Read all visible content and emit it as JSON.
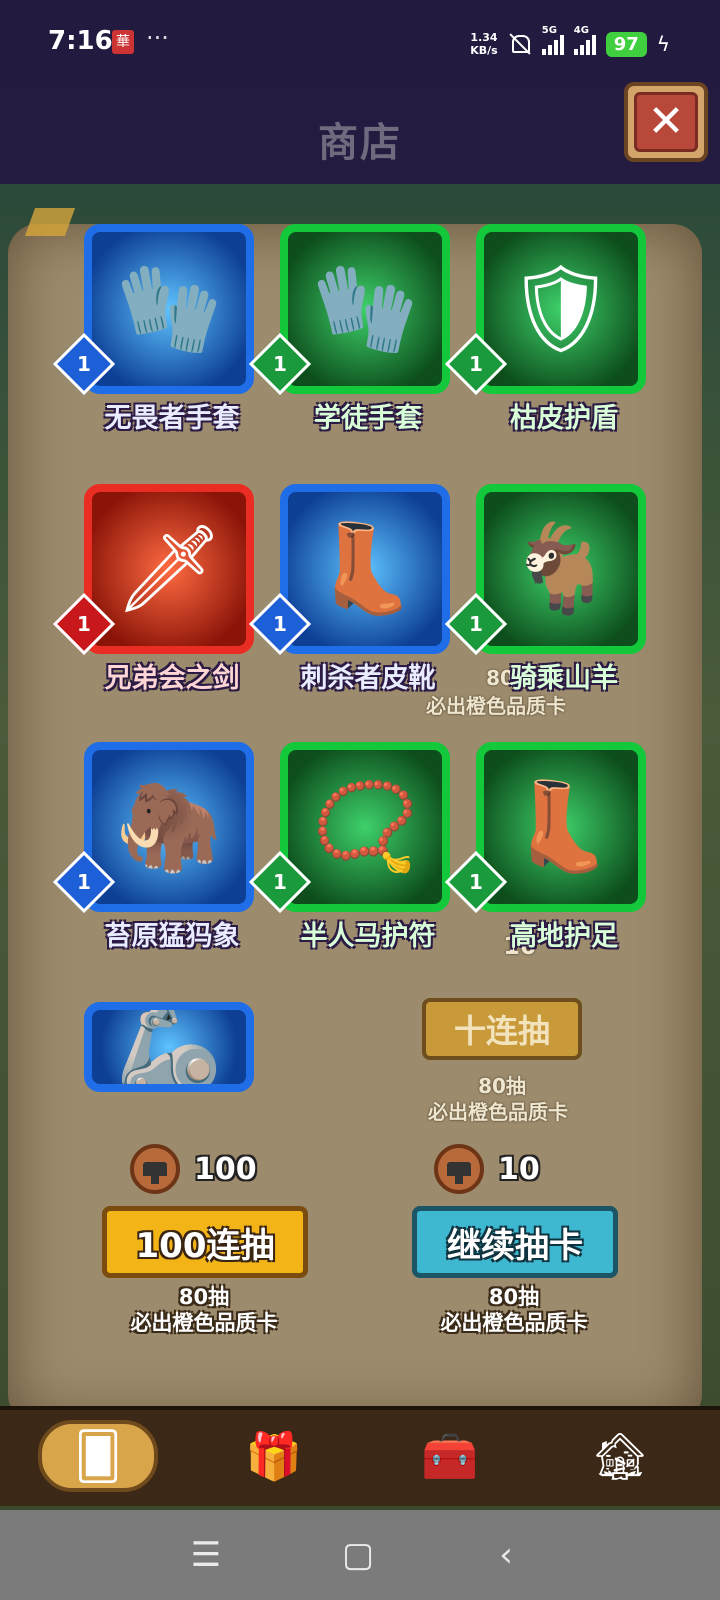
{
  "status_bar": {
    "time": "7:16",
    "app_badge": "華",
    "more": "···",
    "net_speed_value": "1.34",
    "net_speed_unit": "KB/s",
    "signal_1": "5G",
    "signal_2": "4G",
    "battery": "97"
  },
  "header": {
    "title": "商店",
    "close_label": "✕"
  },
  "items": [
    {
      "name": "无畏者手套",
      "level": "1",
      "rarity": "blue",
      "icon": "gauntlet-icon"
    },
    {
      "name": "学徒手套",
      "level": "1",
      "rarity": "green",
      "icon": "glove-icon"
    },
    {
      "name": "枯皮护盾",
      "level": "1",
      "rarity": "green",
      "icon": "shield-icon"
    },
    {
      "name": "兄弟会之剑",
      "level": "1",
      "rarity": "red",
      "icon": "sword-icon"
    },
    {
      "name": "刺杀者皮靴",
      "level": "1",
      "rarity": "blue",
      "icon": "boots-icon"
    },
    {
      "name": "骑乘山羊",
      "level": "1",
      "rarity": "green",
      "icon": "goat-icon"
    },
    {
      "name": "苔原猛犸象",
      "level": "1",
      "rarity": "blue",
      "icon": "mammoth-icon"
    },
    {
      "name": "半人马护符",
      "level": "1",
      "rarity": "green",
      "icon": "amulet-icon"
    },
    {
      "name": "高地护足",
      "level": "1",
      "rarity": "green",
      "icon": "greaves-icon"
    },
    {
      "name": "",
      "level": "",
      "rarity": "blue",
      "icon": "bracer-icon"
    }
  ],
  "background": {
    "ten_draw_label": "十连抽",
    "ghost_guarantee_count": "80抽",
    "ghost_guarantee_text": "必出橙色品质卡",
    "ghost_partial_count": "80",
    "ghost_partial_text": "必出橙色品质卡",
    "ghost_cost": "10"
  },
  "draw_panel": {
    "left": {
      "cost": "100",
      "button": "100连抽",
      "count": "80抽",
      "guarantee": "必出橙色品质卡"
    },
    "right": {
      "cost": "10",
      "button": "继续抽卡",
      "count": "80抽",
      "guarantee": "必出橙色品质卡"
    }
  },
  "bottom_nav": [
    {
      "icon": "card-deck-icon",
      "glyph": "🂠",
      "active": true
    },
    {
      "icon": "gift-icon",
      "glyph": "🎁",
      "active": false
    },
    {
      "icon": "treasure-chest-icon",
      "glyph": "🧰",
      "active": false
    },
    {
      "icon": "house-icon",
      "glyph": "🏚",
      "active": false
    }
  ],
  "system_nav": {
    "menu": "☰",
    "home": "▢",
    "back": "‹"
  },
  "colors": {
    "blue": "#1f6ee8",
    "green": "#13c83a",
    "red": "#ea2d22",
    "yellow_button": "#f2b417",
    "cyan_button": "#3eb7d0"
  }
}
